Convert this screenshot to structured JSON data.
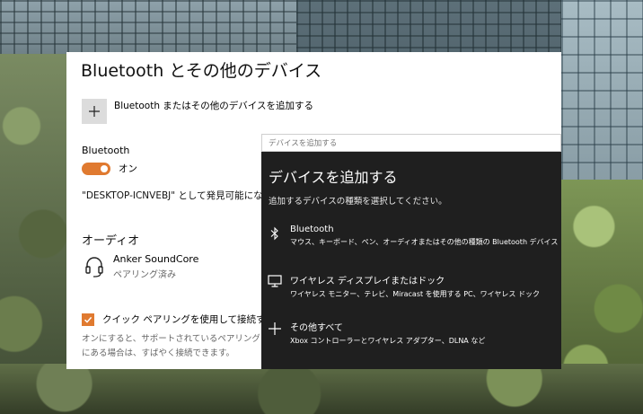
{
  "settings": {
    "title": "Bluetooth とその他のデバイス",
    "add_label": "Bluetooth またはその他のデバイスを追加する",
    "bluetooth_label": "Bluetooth",
    "toggle_state": "オン",
    "discover_text": "\"DESKTOP-ICNVEBJ\" として発見可能になりま",
    "audio_heading": "オーディオ",
    "device": {
      "name": "Anker SoundCore",
      "status": "ペアリング済み",
      "icon": "headset-icon"
    },
    "swift_pair_label": "クイック ペアリングを使用して接続するための",
    "swift_pair_checked": true,
    "help_line1": "オンにすると、サポートされているペアリング モードの",
    "help_line2": "にある場合は、すばやく接続できます。"
  },
  "dialog": {
    "titlebar": "デバイスを追加する",
    "heading": "デバイスを追加する",
    "subtitle": "追加するデバイスの種類を選択してください。",
    "options": [
      {
        "icon": "bluetooth-icon",
        "title": "Bluetooth",
        "desc": "マウス、キーボード、ペン、オーディオまたはその他の種類の Bluetooth デバイス"
      },
      {
        "icon": "monitor-icon",
        "title": "ワイヤレス ディスプレイまたはドック",
        "desc": "ワイヤレス モニター、テレビ、Miracast を使用する PC、ワイヤレス ドック"
      },
      {
        "icon": "plus-icon",
        "title": "その他すべて",
        "desc": "Xbox コントローラーとワイヤレス アダプター、DLNA など"
      }
    ]
  },
  "colors": {
    "accent": "#e07a30",
    "dialog_bg": "#1f1f1f",
    "panel_bg": "#ffffff"
  }
}
